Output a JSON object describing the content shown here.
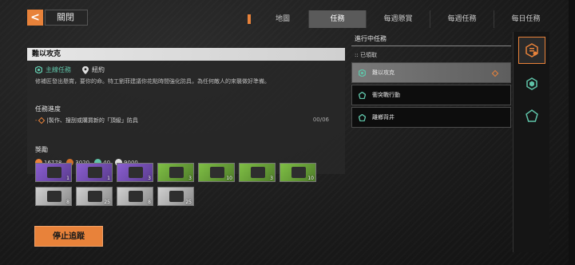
{
  "header": {
    "back_glyph": "<",
    "close_label": "關閉",
    "tabs": [
      {
        "label": "地圖",
        "active": false
      },
      {
        "label": "任務",
        "active": true
      },
      {
        "label": "每週懸賞",
        "active": false
      },
      {
        "label": "每週任務",
        "active": false
      },
      {
        "label": "每日任務",
        "active": false
      }
    ]
  },
  "quest_detail": {
    "title": "難以攻克",
    "type_label": "主線任務",
    "location": "紐約",
    "description": "修補匠發出懸賞，要你的命。特工劉菲建議你花點時間強化防具，為任何敵人的來襲做好準備。",
    "progress_title": "任務進度",
    "objective": "|製作、搜刮或購買新的「頂級」防具",
    "objective_count": "00/06",
    "reward_title": "獎勵",
    "currencies": [
      {
        "icon": "xp-icon",
        "value": "16778",
        "color": "#e8823a"
      },
      {
        "icon": "sp-icon",
        "value": "3020",
        "color": "#d0702c"
      },
      {
        "icon": "shd-icon",
        "value": "40",
        "color": "#5fc3a8"
      },
      {
        "icon": "credit-icon",
        "value": "9000",
        "color": "#e0e0e0"
      }
    ],
    "items_row1": [
      {
        "rarity": "purple",
        "qty": "1"
      },
      {
        "rarity": "purple",
        "qty": "1"
      },
      {
        "rarity": "purple",
        "qty": "3"
      },
      {
        "rarity": "green",
        "qty": "3"
      },
      {
        "rarity": "green",
        "qty": "10"
      },
      {
        "rarity": "green",
        "qty": "3"
      },
      {
        "rarity": "green",
        "qty": "10"
      }
    ],
    "items_row2": [
      {
        "rarity": "gray",
        "qty": "8"
      },
      {
        "rarity": "gray",
        "qty": "25"
      },
      {
        "rarity": "gray",
        "qty": "8"
      },
      {
        "rarity": "gray",
        "qty": "25"
      }
    ],
    "stop_button": "停止追蹤"
  },
  "quest_list": {
    "title": "進行中任務",
    "claimed_label": ":: 已領取",
    "items": [
      {
        "label": "難以攻克",
        "selected": true
      },
      {
        "label": "衝突戰行動",
        "selected": false
      },
      {
        "label": "離鄉背井",
        "selected": false
      }
    ]
  },
  "sidebar": {
    "buttons": [
      "active-quest-icon",
      "hexagon-icon",
      "pentagon-icon"
    ]
  },
  "colors": {
    "accent": "#e8823a",
    "teal": "#5fc3a8",
    "purple": "#8a5ed0",
    "green": "#7fbf45"
  }
}
